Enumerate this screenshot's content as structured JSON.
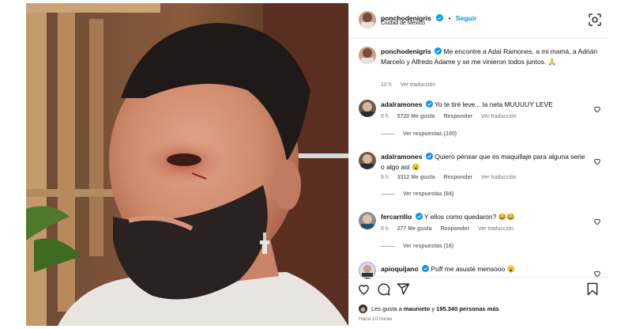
{
  "colors": {
    "accent": "#0095f6",
    "verified": "#0095f6",
    "muted": "#737373",
    "border": "#efefef"
  },
  "post": {
    "author": "ponchodenigris",
    "follow_label": "Seguir",
    "separator": "•",
    "location": "Ciudad de México",
    "caption": "Me encontre a Adal Ramones, a mi mamá, a Adrián Marcelo y Alfredo Adame y se me vinieron todos juntos.",
    "caption_emoji": "🙏",
    "time": "10 h",
    "translate_label": "Ver traducción"
  },
  "comments": [
    {
      "user": "adalramones",
      "text": "Yo te tiré leve... la neta MUUUUY LEVE",
      "time": "9 h",
      "likes": "5720 Me gusta",
      "reply_label": "Responder",
      "translate_label": "Ver traducción",
      "replies_label": "Ver respuestas (100)"
    },
    {
      "user": "adalramones",
      "text": "Quiero pensar que es maquillaje para alguna serie o algo así 😮",
      "time": "9 h",
      "likes": "3312 Me gusta",
      "reply_label": "Responder",
      "translate_label": "Ver traducción",
      "replies_label": "Ver respuestas (84)"
    },
    {
      "user": "fercarrillo",
      "text": "Y ellos como quedaron? 😂😂",
      "time": "9 h",
      "likes": "277 Me gusta",
      "reply_label": "Responder",
      "translate_label": "Ver traducción",
      "replies_label": "Ver respuestas (16)"
    },
    {
      "user": "apioquijano",
      "text": "Puff me asusté mensooo 😮"
    }
  ],
  "footer": {
    "likes_prefix": "Les gusta a",
    "likes_user": "maunieto",
    "likes_middle": "y",
    "likes_count": "195.340 personas más",
    "posted_time": "Hace 10 horas"
  },
  "icons": [
    "qr-scan-icon",
    "verified-badge-icon",
    "heart-icon",
    "comment-icon",
    "share-icon",
    "bookmark-icon"
  ]
}
